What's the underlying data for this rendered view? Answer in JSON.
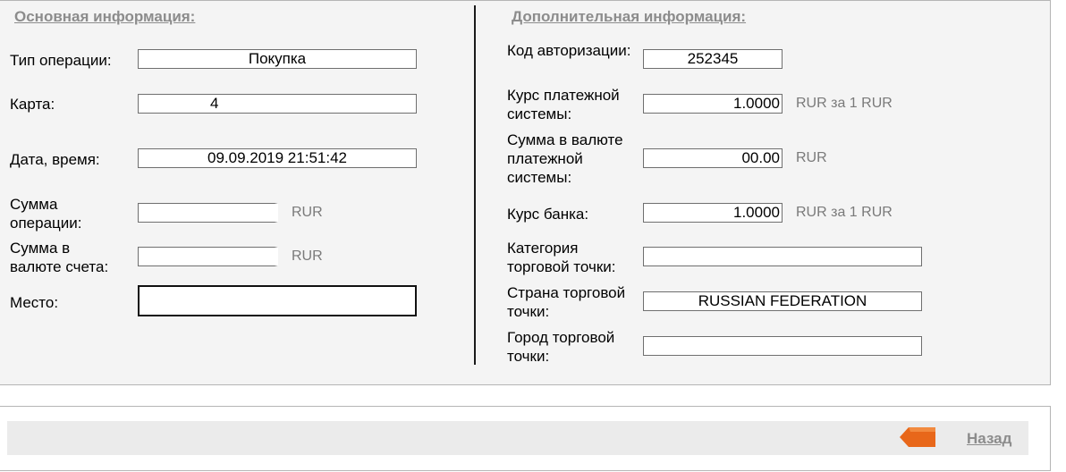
{
  "left": {
    "title": "Основная информация:",
    "rows": [
      {
        "label": "Тип операции:",
        "value": "Покупка",
        "unit": ""
      },
      {
        "label": "Карта:",
        "value": "4",
        "unit": ""
      },
      {
        "label": "Дата, время:",
        "value": "09.09.2019 21:51:42",
        "unit": ""
      },
      {
        "label": "Сумма операции:",
        "value": "",
        "unit": "RUR"
      },
      {
        "label": "Сумма в валюте счета:",
        "value": "",
        "unit": "RUR"
      },
      {
        "label": "Место:",
        "value": "",
        "unit": ""
      }
    ]
  },
  "right": {
    "title": "Дополнительная информация:",
    "rows": [
      {
        "label": "Код авторизации:",
        "value": "252345",
        "unit": ""
      },
      {
        "label": "Курс платежной системы:",
        "value": "1.0000",
        "unit": "RUR за 1 RUR"
      },
      {
        "label": "Сумма в валюте платежной системы:",
        "value": "00.00",
        "unit": "RUR"
      },
      {
        "label": "Курс банка:",
        "value": "1.0000",
        "unit": "RUR за 1 RUR"
      },
      {
        "label": "Категория торговой точки:",
        "value": "",
        "unit": ""
      },
      {
        "label": "Страна торговой точки:",
        "value": "RUSSIAN FEDERATION",
        "unit": ""
      },
      {
        "label": "Город торговой точки:",
        "value": "",
        "unit": ""
      }
    ]
  },
  "footer": {
    "back_label": "Назад",
    "back_icon": "back-arrow-icon",
    "accent": "#e8671a"
  }
}
